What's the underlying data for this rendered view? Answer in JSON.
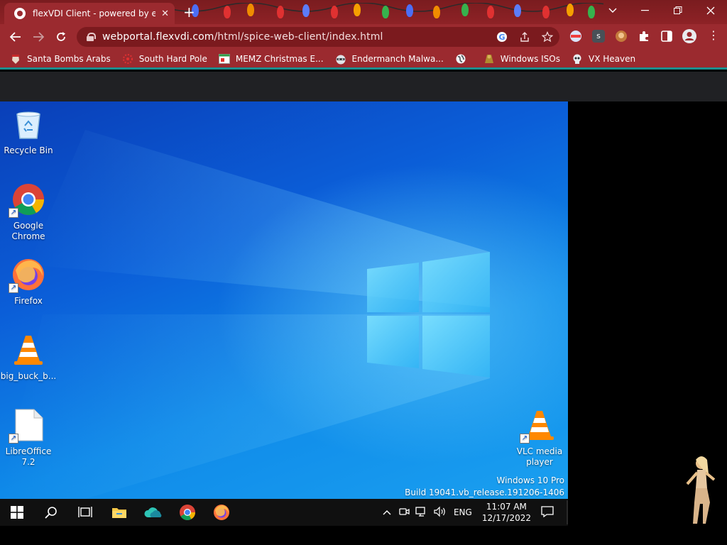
{
  "browser": {
    "tab_title": "flexVDI Client - powered by eyeOS",
    "tab_close": "✕",
    "new_tab": "+",
    "url_host": "webportal.flexvdi.com",
    "url_path": "/html/spice-web-client/index.html"
  },
  "bookmarks": [
    {
      "label": "Santa Bombs Arabs",
      "icon": "santa-icon"
    },
    {
      "label": "South Hard Pole",
      "icon": "snowflake-icon"
    },
    {
      "label": "MEMZ Christmas E...",
      "icon": "window-icon"
    },
    {
      "label": "Endermanch Malwa...",
      "icon": "raccoon-icon"
    },
    {
      "label": "",
      "icon": "globe-icon"
    },
    {
      "label": "Windows ISOs",
      "icon": "folder-icon"
    },
    {
      "label": "VX Heaven",
      "icon": "skull-icon"
    }
  ],
  "desktop": {
    "icons": [
      {
        "label": "Recycle Bin"
      },
      {
        "label": "Google Chrome"
      },
      {
        "label": "Firefox"
      },
      {
        "label": "big_buck_b..."
      },
      {
        "label": "LibreOffice 7.2"
      },
      {
        "label": "VLC media player"
      }
    ],
    "watermark": {
      "edition": "Windows 10 Pro",
      "build": "Build 19041.vb_release.191206-1406"
    }
  },
  "taskbar": {
    "language": "ENG",
    "time": "11:07 AM",
    "date": "12/17/2022"
  },
  "colors": {
    "chrome_frame": "#9b2a2f",
    "taskbar": "#101010",
    "desktop_blue": "#0b5ed8"
  }
}
